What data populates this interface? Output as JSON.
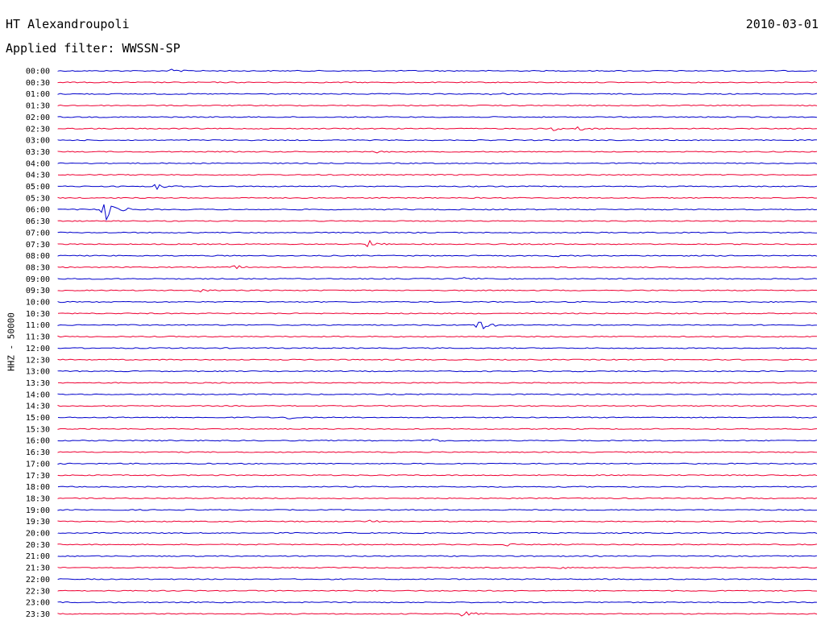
{
  "header": {
    "station": "HT Alexandroupoli",
    "date": "2010-03-01",
    "filter": "Applied filter: WWSSN-SP"
  },
  "chart_data": {
    "type": "line",
    "ylabel": "HHZ - 50000",
    "rows": [
      "00:00",
      "00:30",
      "01:00",
      "01:30",
      "02:00",
      "02:30",
      "03:00",
      "03:30",
      "04:00",
      "04:30",
      "05:00",
      "05:30",
      "06:00",
      "06:30",
      "07:00",
      "07:30",
      "08:00",
      "08:30",
      "09:00",
      "09:30",
      "10:00",
      "10:30",
      "11:00",
      "11:30",
      "12:00",
      "12:30",
      "13:00",
      "13:30",
      "14:00",
      "14:30",
      "15:00",
      "15:30",
      "16:00",
      "16:30",
      "17:00",
      "17:30",
      "18:00",
      "18:30",
      "19:00",
      "19:30",
      "20:00",
      "20:30",
      "21:00",
      "21:30",
      "22:00",
      "22:30",
      "23:00",
      "23:30"
    ],
    "series_colors": [
      "#0000cc",
      "#ee0033"
    ],
    "events": [
      {
        "row": "00:00",
        "minute": 4.5,
        "amplitude": 3
      },
      {
        "row": "01:00",
        "minute": 17.0,
        "amplitude": 3
      },
      {
        "row": "02:30",
        "minute": 19.5,
        "amplitude": 3
      },
      {
        "row": "02:30",
        "minute": 20.5,
        "amplitude": 4
      },
      {
        "row": "03:30",
        "minute": 12.5,
        "amplitude": 2
      },
      {
        "row": "05:00",
        "minute": 3.9,
        "amplitude": 4
      },
      {
        "row": "06:00",
        "minute": 1.8,
        "amplitude": 17
      },
      {
        "row": "07:30",
        "minute": 12.3,
        "amplitude": 7
      },
      {
        "row": "08:00",
        "minute": 19.5,
        "amplitude": 2
      },
      {
        "row": "08:30",
        "minute": 7.0,
        "amplitude": 3
      },
      {
        "row": "09:00",
        "minute": 16.0,
        "amplitude": 3
      },
      {
        "row": "09:30",
        "minute": 5.5,
        "amplitude": 3
      },
      {
        "row": "11:00",
        "minute": 16.6,
        "amplitude": 7
      },
      {
        "row": "15:00",
        "minute": 9.0,
        "amplitude": 3
      },
      {
        "row": "16:00",
        "minute": 14.8,
        "amplitude": 3
      },
      {
        "row": "19:30",
        "minute": 12.2,
        "amplitude": 2
      },
      {
        "row": "20:30",
        "minute": 17.7,
        "amplitude": 2
      },
      {
        "row": "21:30",
        "minute": 19.7,
        "amplitude": 2
      },
      {
        "row": "23:30",
        "minute": 16.0,
        "amplitude": 4
      }
    ],
    "x_range_minutes": [
      0,
      30
    ],
    "grid": false
  }
}
